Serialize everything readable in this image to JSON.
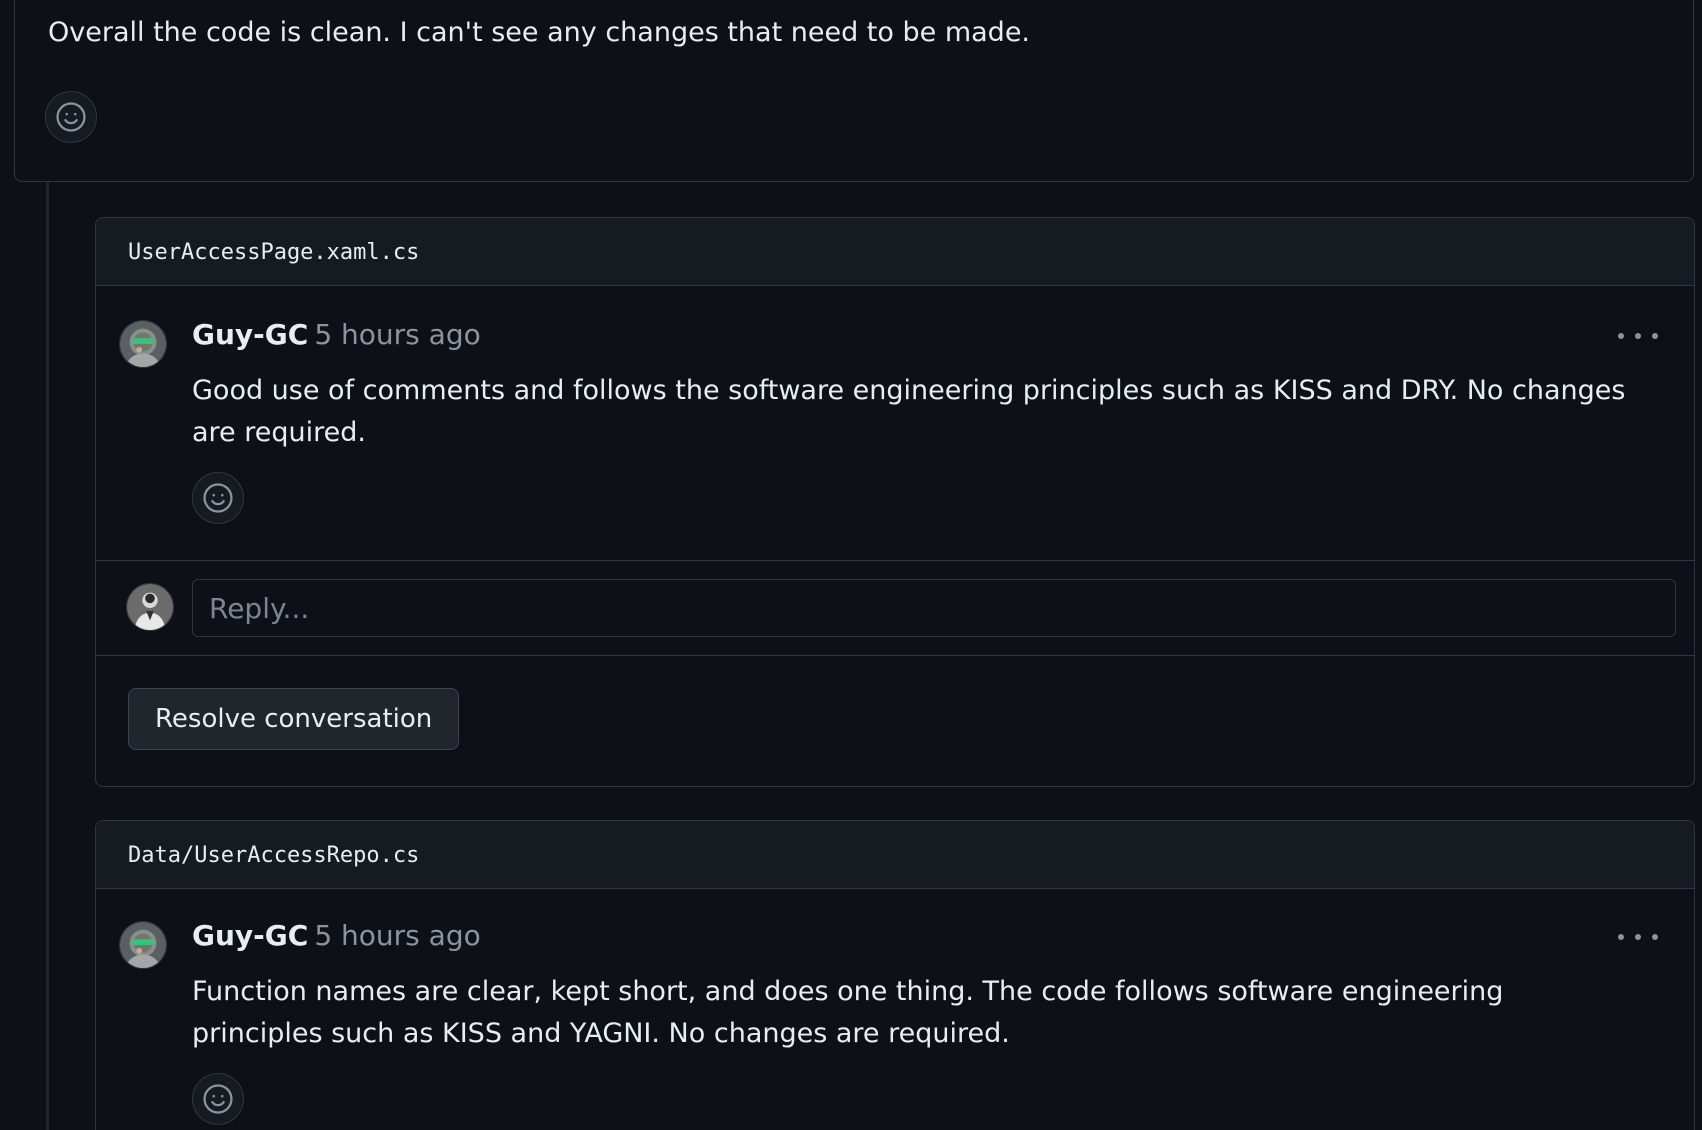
{
  "review": {
    "text": "Overall the code is clean. I can't see any changes that need to be made.",
    "reaction_icon": "smiley-icon"
  },
  "threads": [
    {
      "file_path": "UserAccessPage.xaml.cs",
      "comment": {
        "author": "Guy-GC",
        "time": "5 hours ago",
        "body": "Good use of comments and follows the software engineering principles such as KISS and DRY. No changes are required."
      },
      "reply_placeholder": "Reply...",
      "resolve_label": "Resolve conversation"
    },
    {
      "file_path": "Data/UserAccessRepo.cs",
      "comment": {
        "author": "Guy-GC",
        "time": "5 hours ago",
        "body": "Function names are clear, kept short, and does one thing. The code follows software engineering principles such as KISS and YAGNI. No changes are required."
      }
    }
  ],
  "colors": {
    "background": "#0d1117",
    "border": "#30363d",
    "header_bg": "#161b22",
    "text": "#e6edf3",
    "muted": "#8b949e"
  }
}
